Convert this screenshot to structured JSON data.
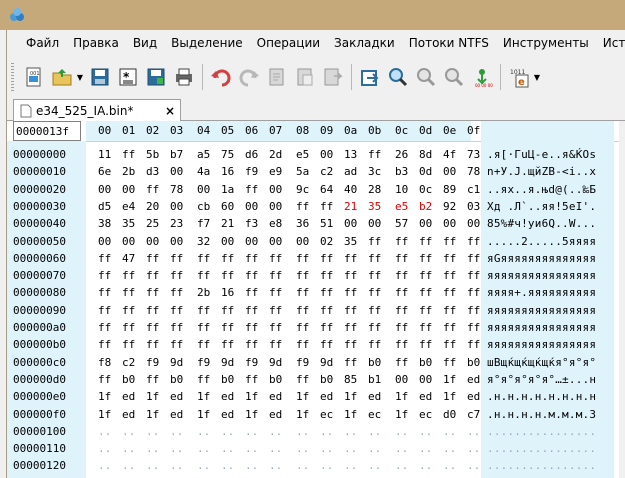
{
  "menu": [
    "Файл",
    "Правка",
    "Вид",
    "Выделение",
    "Операции",
    "Закладки",
    "Потоки NTFS",
    "Инструменты",
    "История"
  ],
  "toolbar_buttons": [
    "new-file-icon",
    "open-file-icon",
    "open-dropdown",
    "save-icon",
    "save-all-icon",
    "save-as-icon",
    "print-icon",
    "undo-icon",
    "redo-icon",
    "clipboard-copy-icon",
    "clipboard-paste-icon",
    "clipboard-special-icon",
    "goto-icon",
    "find-icon",
    "find-next-icon",
    "find-prev-icon",
    "bookmark-icon",
    "data-inspector-icon"
  ],
  "tab": {
    "label": "e34_525_IA.bin*",
    "close": "×"
  },
  "header": {
    "offset": "0000013f",
    "cols": [
      "00",
      "01",
      "02",
      "03",
      "04",
      "05",
      "06",
      "07",
      "08",
      "09",
      "0a",
      "0b",
      "0c",
      "0d",
      "0e",
      "0f"
    ]
  },
  "rows": [
    {
      "offset": "00000000",
      "bytes": [
        "11",
        "ff",
        "5b",
        "b7",
        "a5",
        "75",
        "d6",
        "2d",
        "e5",
        "00",
        "13",
        "ff",
        "26",
        "8d",
        "4f",
        "73"
      ],
      "text": ".я[·ГuЦ-е..я&ЌOs"
    },
    {
      "offset": "00000010",
      "bytes": [
        "6e",
        "2b",
        "d3",
        "00",
        "4a",
        "16",
        "f9",
        "e9",
        "5a",
        "c2",
        "ad",
        "3c",
        "b3",
        "0d",
        "00",
        "78"
      ],
      "text": "n+У.J.щйZВ-<і..x"
    },
    {
      "offset": "00000020",
      "bytes": [
        "00",
        "00",
        "ff",
        "78",
        "00",
        "1a",
        "ff",
        "00",
        "9c",
        "64",
        "40",
        "28",
        "10",
        "0c",
        "89",
        "c1"
      ],
      "text": "..яx..я.њd@(..‰Б"
    },
    {
      "offset": "00000030",
      "bytes": [
        "d5",
        "e4",
        "20",
        "00",
        "cb",
        "60",
        "00",
        "00",
        "ff",
        "ff",
        "21",
        "35",
        "e5",
        "b2",
        "92",
        "03"
      ],
      "text": "Хд .Л`..яя!5еІ'.",
      "red": [
        10,
        11,
        12,
        13
      ]
    },
    {
      "offset": "00000040",
      "bytes": [
        "38",
        "35",
        "25",
        "23",
        "f7",
        "21",
        "f3",
        "e8",
        "36",
        "51",
        "00",
        "00",
        "57",
        "00",
        "00",
        "00"
      ],
      "text": "85%#ч!уи6Q..W..."
    },
    {
      "offset": "00000050",
      "bytes": [
        "00",
        "00",
        "00",
        "00",
        "32",
        "00",
        "00",
        "00",
        "00",
        "02",
        "35",
        "ff",
        "ff",
        "ff",
        "ff",
        "ff"
      ],
      "text": ".....2.....5яяяя"
    },
    {
      "offset": "00000060",
      "bytes": [
        "ff",
        "47",
        "ff",
        "ff",
        "ff",
        "ff",
        "ff",
        "ff",
        "ff",
        "ff",
        "ff",
        "ff",
        "ff",
        "ff",
        "ff",
        "ff"
      ],
      "text": "яGяяяяяяяяяяяяяя"
    },
    {
      "offset": "00000070",
      "bytes": [
        "ff",
        "ff",
        "ff",
        "ff",
        "ff",
        "ff",
        "ff",
        "ff",
        "ff",
        "ff",
        "ff",
        "ff",
        "ff",
        "ff",
        "ff",
        "ff"
      ],
      "text": "яяяяяяяяяяяяяяяя"
    },
    {
      "offset": "00000080",
      "bytes": [
        "ff",
        "ff",
        "ff",
        "ff",
        "2b",
        "16",
        "ff",
        "ff",
        "ff",
        "ff",
        "ff",
        "ff",
        "ff",
        "ff",
        "ff",
        "ff"
      ],
      "text": "яяяя+.яяяяяяяяяя"
    },
    {
      "offset": "00000090",
      "bytes": [
        "ff",
        "ff",
        "ff",
        "ff",
        "ff",
        "ff",
        "ff",
        "ff",
        "ff",
        "ff",
        "ff",
        "ff",
        "ff",
        "ff",
        "ff",
        "ff"
      ],
      "text": "яяяяяяяяяяяяяяяя"
    },
    {
      "offset": "000000a0",
      "bytes": [
        "ff",
        "ff",
        "ff",
        "ff",
        "ff",
        "ff",
        "ff",
        "ff",
        "ff",
        "ff",
        "ff",
        "ff",
        "ff",
        "ff",
        "ff",
        "ff"
      ],
      "text": "яяяяяяяяяяяяяяяя"
    },
    {
      "offset": "000000b0",
      "bytes": [
        "ff",
        "ff",
        "ff",
        "ff",
        "ff",
        "ff",
        "ff",
        "ff",
        "ff",
        "ff",
        "ff",
        "ff",
        "ff",
        "ff",
        "ff",
        "ff"
      ],
      "text": "яяяяяяяяяяяяяяяя"
    },
    {
      "offset": "000000c0",
      "bytes": [
        "f8",
        "c2",
        "f9",
        "9d",
        "f9",
        "9d",
        "f9",
        "9d",
        "f9",
        "9d",
        "ff",
        "b0",
        "ff",
        "b0",
        "ff",
        "b0"
      ],
      "text": "шВщќщќщќщќя°я°я°"
    },
    {
      "offset": "000000d0",
      "bytes": [
        "ff",
        "b0",
        "ff",
        "b0",
        "ff",
        "b0",
        "ff",
        "b0",
        "ff",
        "b0",
        "85",
        "b1",
        "00",
        "00",
        "1f",
        "ed"
      ],
      "text": "я°я°я°я°я°…±...н"
    },
    {
      "offset": "000000e0",
      "bytes": [
        "1f",
        "ed",
        "1f",
        "ed",
        "1f",
        "ed",
        "1f",
        "ed",
        "1f",
        "ed",
        "1f",
        "ed",
        "1f",
        "ed",
        "1f",
        "ed"
      ],
      "text": ".н.н.н.н.н.н.н.н"
    },
    {
      "offset": "000000f0",
      "bytes": [
        "1f",
        "ed",
        "1f",
        "ed",
        "1f",
        "ed",
        "1f",
        "ed",
        "1f",
        "ec",
        "1f",
        "ec",
        "1f",
        "ec",
        "d0",
        "c7"
      ],
      "text": ".н.н.н.н.м.м.м.З"
    },
    {
      "offset": "00000100",
      "bytes": [
        "..",
        "..",
        "..",
        "..",
        "..",
        "..",
        "..",
        "..",
        "..",
        "..",
        "..",
        "..",
        "..",
        "..",
        "..",
        ".."
      ],
      "text": "................",
      "empty": true
    },
    {
      "offset": "00000110",
      "bytes": [
        "..",
        "..",
        "..",
        "..",
        "..",
        "..",
        "..",
        "..",
        "..",
        "..",
        "..",
        "..",
        "..",
        "..",
        "..",
        ".."
      ],
      "text": "................",
      "empty": true
    },
    {
      "offset": "00000120",
      "bytes": [
        "..",
        "..",
        "..",
        "..",
        "..",
        "..",
        "..",
        "..",
        "..",
        "..",
        "..",
        "..",
        "..",
        "..",
        "..",
        ".."
      ],
      "text": "................",
      "empty": true
    }
  ]
}
